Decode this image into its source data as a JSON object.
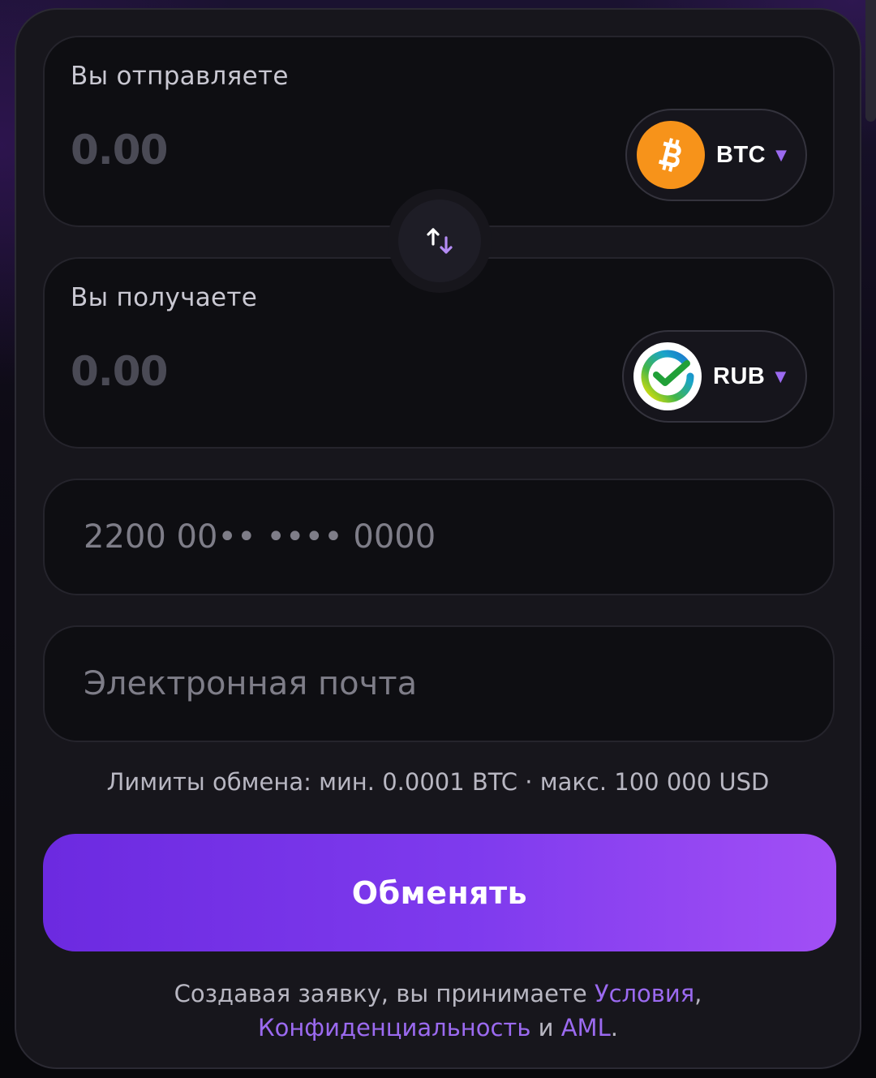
{
  "send": {
    "label": "Вы отправляете",
    "amount": "0.00",
    "currency": {
      "ticker": "BTC",
      "icon": "bitcoin-icon",
      "icon_color": "#f7931a",
      "caret": "▼"
    }
  },
  "receive": {
    "label": "Вы получаете",
    "amount": "0.00",
    "currency": {
      "ticker": "RUB",
      "icon": "sberbank-icon",
      "caret": "▼"
    }
  },
  "swap": {
    "icon": "swap-arrows-icon"
  },
  "card_field": {
    "placeholder": "2200 00•• •••• 0000"
  },
  "email_field": {
    "placeholder": "Электронная почта"
  },
  "limits": "Лимиты обмена: мин. 0.0001 BTC · макс. 100 000 USD",
  "cta": {
    "label": "Обменять"
  },
  "terms": {
    "prefix": "Создавая заявку, вы принимаете ",
    "terms_link": "Условия",
    "comma": ",",
    "privacy_link": "Конфиденциальность",
    "and": " и ",
    "aml_link": "AML",
    "period": "."
  },
  "colors": {
    "accent": "#9b6af0",
    "cta_start": "#6c2ae0",
    "cta_end": "#a24ff5",
    "card_bg": "#17161c",
    "field_bg": "#0e0e12"
  }
}
